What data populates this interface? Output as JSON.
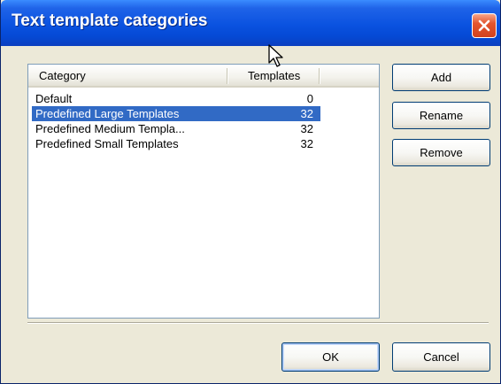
{
  "window": {
    "title": "Text template categories"
  },
  "list": {
    "columns": [
      "Category",
      "Templates"
    ],
    "rows": [
      {
        "category": "Default",
        "templates": "0",
        "selected": false
      },
      {
        "category": "Predefined Large Templates",
        "templates": "32",
        "selected": true
      },
      {
        "category": "Predefined Medium Templa...",
        "templates": "32",
        "selected": false
      },
      {
        "category": "Predefined Small Templates",
        "templates": "32",
        "selected": false
      }
    ]
  },
  "buttons": {
    "add": "Add",
    "rename": "Rename",
    "remove": "Remove",
    "ok": "OK",
    "cancel": "Cancel"
  },
  "icons": {
    "close": "close-icon",
    "cursor": "mouse-pointer-icon"
  },
  "colors": {
    "selection": "#316ac5",
    "titlebar": "#0a52e0",
    "close": "#d2421e"
  }
}
